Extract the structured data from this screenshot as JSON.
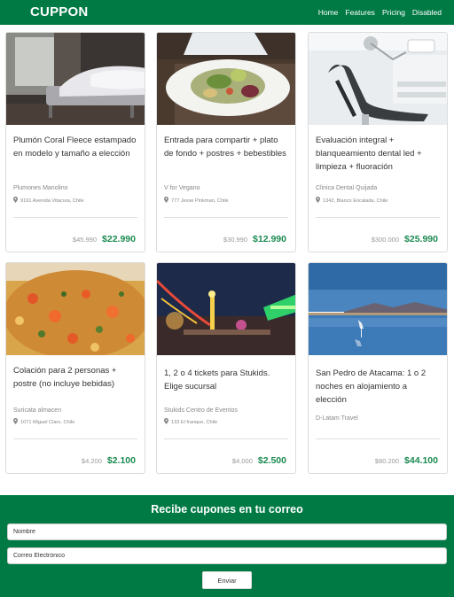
{
  "navbar": {
    "brand": "CUPPON",
    "links": [
      "Home",
      "Features",
      "Pricing",
      "Disabled"
    ]
  },
  "deals": [
    {
      "image": "bedroom-photo",
      "title": "Plumón Coral Fleece estampado en modelo y tamaño a elección",
      "merchant": "Plumones Manolino",
      "address": "9191 Avenida Vitacura, Chile",
      "old_price": "$45.990",
      "new_price": "$22.990"
    },
    {
      "image": "salad-dish-photo",
      "title": "Entrada para compartir + plato de fondo + postres + bebestibles",
      "merchant": "V for Vegano",
      "address": "777 Jesse Pinkman, Chile",
      "old_price": "$30.990",
      "new_price": "$12.990"
    },
    {
      "image": "dental-chair-photo",
      "title": "Evaluación integral + blanqueamiento dental led + limpieza + fluoración",
      "merchant": "Clinica Dental Quijada",
      "address": "1342, Blanco Encalada, Chile",
      "old_price": "$300.000",
      "new_price": "$25.990"
    },
    {
      "image": "rice-dish-photo",
      "title": "Colación para 2 personas + postre (no incluye bebidas)",
      "merchant": "Suricata almacen",
      "address": "1071 Miguel Claro, Chile",
      "old_price": "$4.200",
      "new_price": "$2.100"
    },
    {
      "image": "fair-night-photo",
      "title": "1, 2 o 4 tickets para Stukids. Elige sucursal",
      "merchant": "Stukids Centro de Eventos",
      "address": "133 El franque, Chile",
      "old_price": "$4.000",
      "new_price": "$2.500"
    },
    {
      "image": "lagoon-flamingo-photo",
      "title": "San Pedro de Atacama: 1 o 2 noches en alojamiento a elección",
      "merchant": "D-Latam Travel",
      "address": "",
      "old_price": "$80.200",
      "new_price": "$44.100"
    }
  ],
  "subscribe": {
    "title": "Recibe cupones en tu correo",
    "name_placeholder": "Nombre",
    "email_placeholder": "Correo Electrónico",
    "send_label": "Enviar"
  },
  "colors": {
    "brand_green": "#007a45",
    "price_green": "#1a8a50"
  }
}
